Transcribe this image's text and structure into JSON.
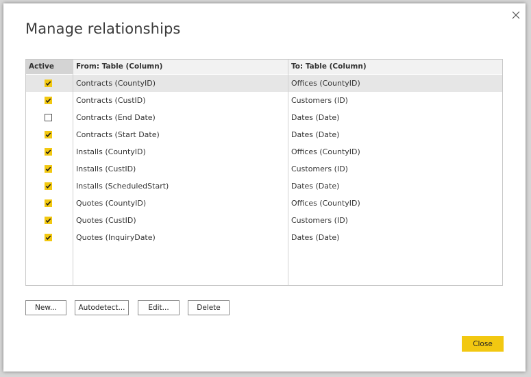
{
  "dialog": {
    "title": "Manage relationships"
  },
  "table": {
    "headers": {
      "active": "Active",
      "from": "From: Table (Column)",
      "to": "To: Table (Column)"
    },
    "rows": [
      {
        "active": true,
        "from": "Contracts (CountyID)",
        "to": "Offices (CountyID)",
        "selected": true
      },
      {
        "active": true,
        "from": "Contracts (CustID)",
        "to": "Customers (ID)",
        "selected": false
      },
      {
        "active": false,
        "from": "Contracts (End Date)",
        "to": "Dates (Date)",
        "selected": false
      },
      {
        "active": true,
        "from": "Contracts (Start Date)",
        "to": "Dates (Date)",
        "selected": false
      },
      {
        "active": true,
        "from": "Installs (CountyID)",
        "to": "Offices (CountyID)",
        "selected": false
      },
      {
        "active": true,
        "from": "Installs (CustID)",
        "to": "Customers (ID)",
        "selected": false
      },
      {
        "active": true,
        "from": "Installs (ScheduledStart)",
        "to": "Dates (Date)",
        "selected": false
      },
      {
        "active": true,
        "from": "Quotes (CountyID)",
        "to": "Offices (CountyID)",
        "selected": false
      },
      {
        "active": true,
        "from": "Quotes (CustID)",
        "to": "Customers (ID)",
        "selected": false
      },
      {
        "active": true,
        "from": "Quotes (InquiryDate)",
        "to": "Dates (Date)",
        "selected": false
      }
    ]
  },
  "buttons": {
    "new": "New...",
    "autodetect": "Autodetect...",
    "edit": "Edit...",
    "delete": "Delete",
    "close": "Close"
  },
  "icons": {
    "close": "close-icon",
    "check": "checkmark-icon"
  },
  "colors": {
    "accent": "#f2c811",
    "selected_row": "#e6e6e6",
    "header_active": "#d4d4d4"
  }
}
